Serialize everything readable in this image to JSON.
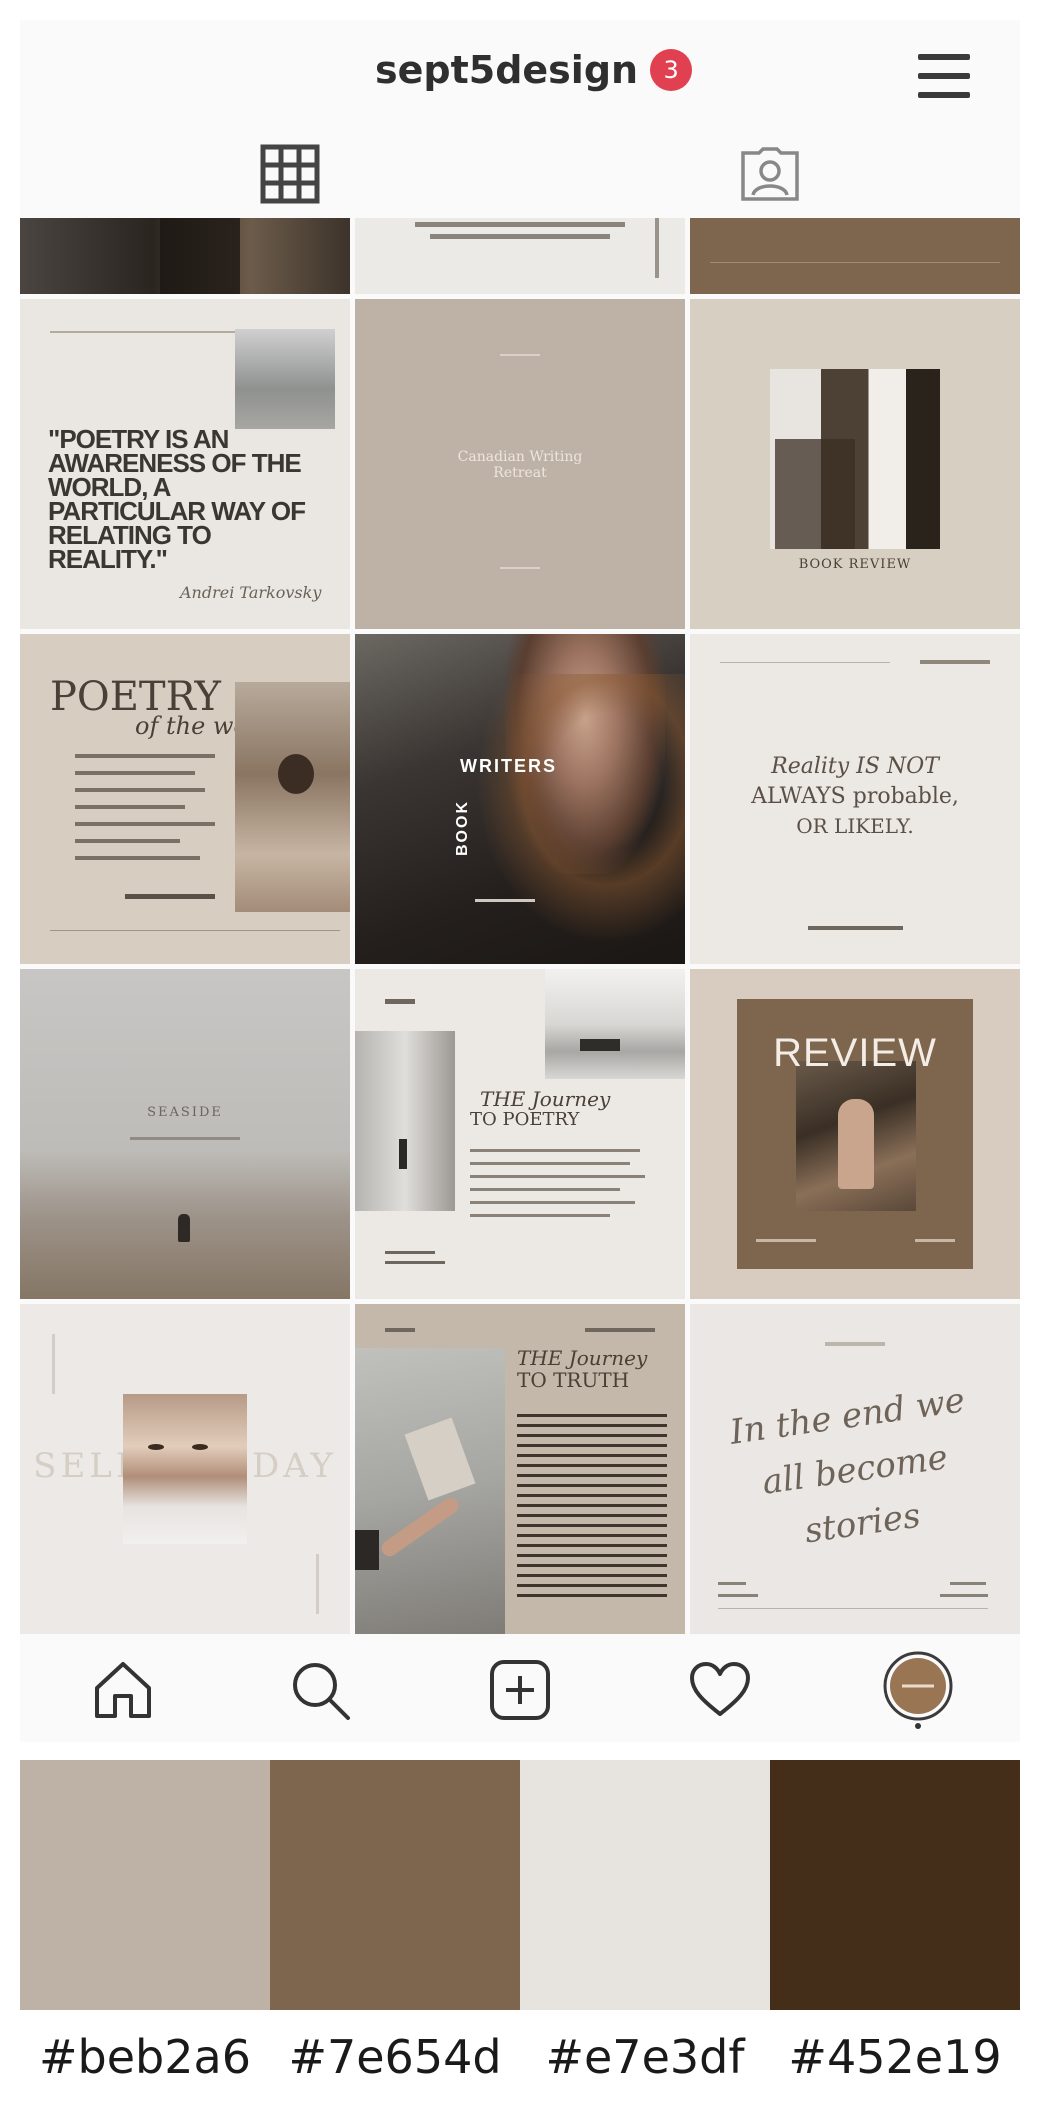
{
  "profile": {
    "username": "sept5design",
    "notification_count": "3"
  },
  "tabs": {
    "grid_icon": "grid-icon",
    "tagged_icon": "tagged-icon"
  },
  "posts": {
    "row0_a": "",
    "row0_b_text": "",
    "row1_quote": "\"POETRY IS AN AWARENESS OF THE WORLD, A PARTICULAR WAY OF RELATING TO REALITY.\"",
    "row1_quote_author": "Andrei Tarkovsky",
    "row1_label": "Canadian Writing Retreat",
    "row1_book_title": "BOOK REVIEW",
    "row2_poetry_title": "POETRY",
    "row2_poetry_sub": "of the week",
    "row2_writers_top": "WRITERS",
    "row2_writers_side": "BOOK",
    "row2_reality_1": "Reality IS NOT",
    "row2_reality_2": "ALWAYS probable,",
    "row2_reality_3": "OR LIKELY.",
    "row3_beach": "SEASIDE",
    "row3_journey_1": "THE Journey",
    "row3_journey_2": "TO POETRY",
    "row3_review": "REVIEW",
    "row4_sunday": "SELF SUNDAY",
    "row4_truth_1": "THE Journey",
    "row4_truth_2": "TO TRUTH",
    "row4_script": "In the end we all become stories"
  },
  "bottom_nav": {
    "home": "home-icon",
    "search": "search-icon",
    "add": "add-post-icon",
    "activity": "heart-icon",
    "profile": "profile-avatar"
  },
  "palette": [
    {
      "hex": "#beb2a6",
      "label": "#beb2a6"
    },
    {
      "hex": "#7e654d",
      "label": "#7e654d"
    },
    {
      "hex": "#e7e3df",
      "label": "#e7e3df"
    },
    {
      "hex": "#452e19",
      "label": "#452e19"
    }
  ]
}
